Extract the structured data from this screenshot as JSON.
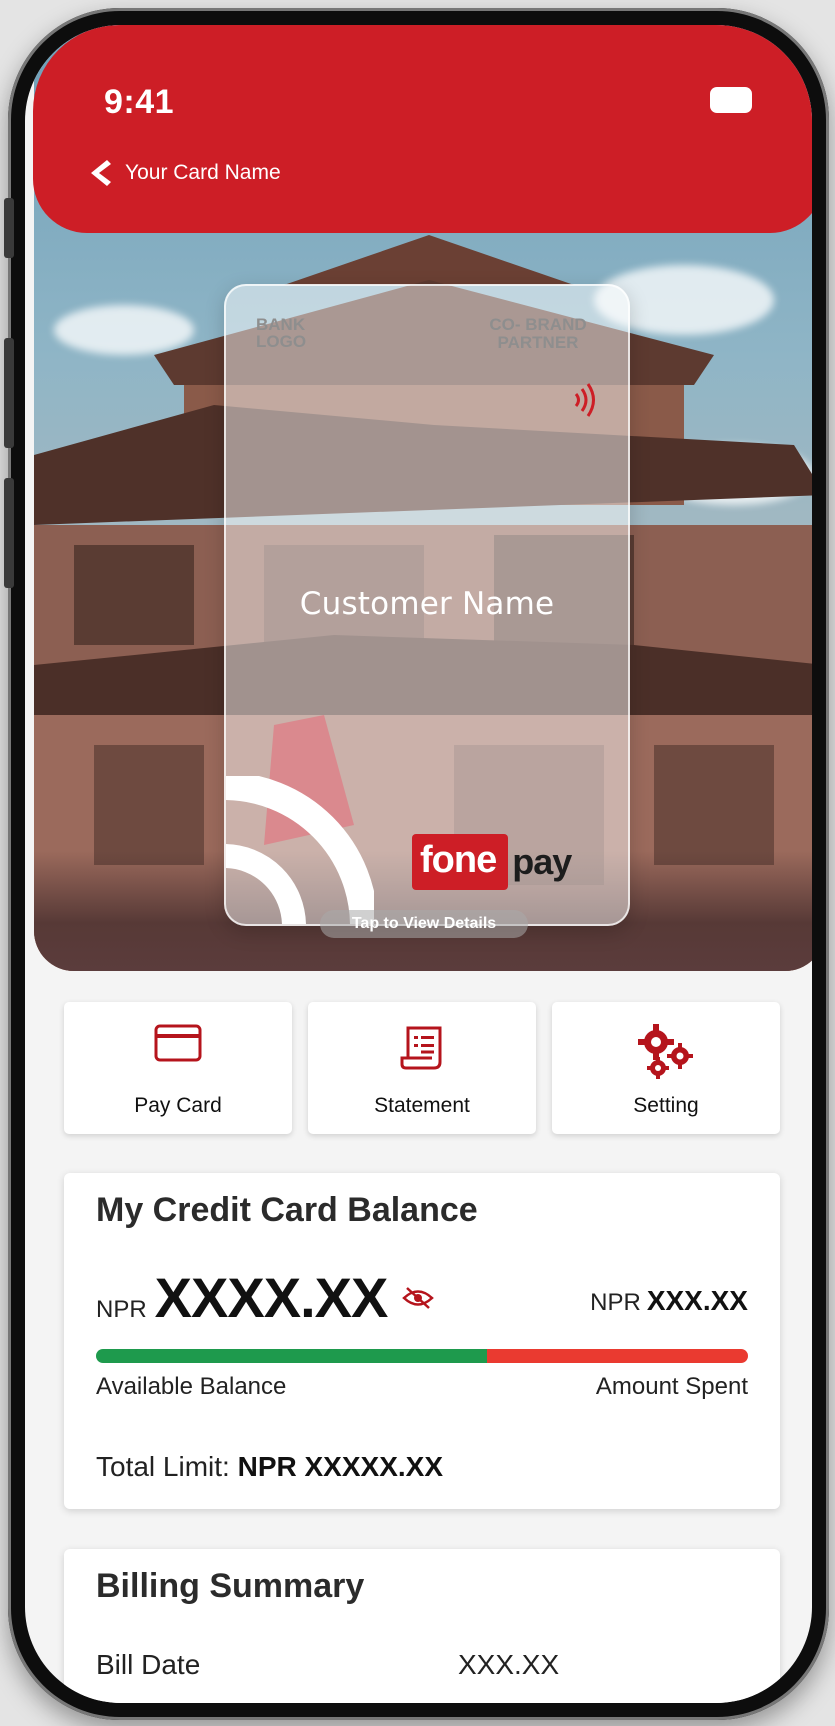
{
  "status_bar": {
    "time": "9:41"
  },
  "header": {
    "title": "Your Card Name"
  },
  "card": {
    "bank_logo_line1": "BANK",
    "bank_logo_line2": "LOGO",
    "cobrand_line1": "CO- BRAND",
    "cobrand_line2": "PARTNER",
    "customer_name": "Customer Name",
    "brand_fone": "fone",
    "brand_pay": "pay",
    "tap_hint": "Tap to View Details"
  },
  "actions": [
    {
      "label": "Pay Card",
      "icon": "card-icon"
    },
    {
      "label": "Statement",
      "icon": "receipt-icon"
    },
    {
      "label": "Setting",
      "icon": "gears-icon"
    }
  ],
  "balance": {
    "title": "My Credit Card Balance",
    "currency": "NPR",
    "available": "XXXX.XX",
    "spent": "XXX.XX",
    "available_fraction": 0.6,
    "available_label": "Available Balance",
    "spent_label": "Amount Spent",
    "limit_label": "Total Limit:",
    "limit_value": "NPR XXXXX.XX",
    "colors": {
      "available": "#1e9a4d",
      "spent": "#ea3a30"
    }
  },
  "billing": {
    "title": "Billing Summary",
    "rows": [
      {
        "label": "Bill Date",
        "value": "XXX.XX"
      }
    ]
  },
  "theme": {
    "accent": "#cd1e26"
  }
}
